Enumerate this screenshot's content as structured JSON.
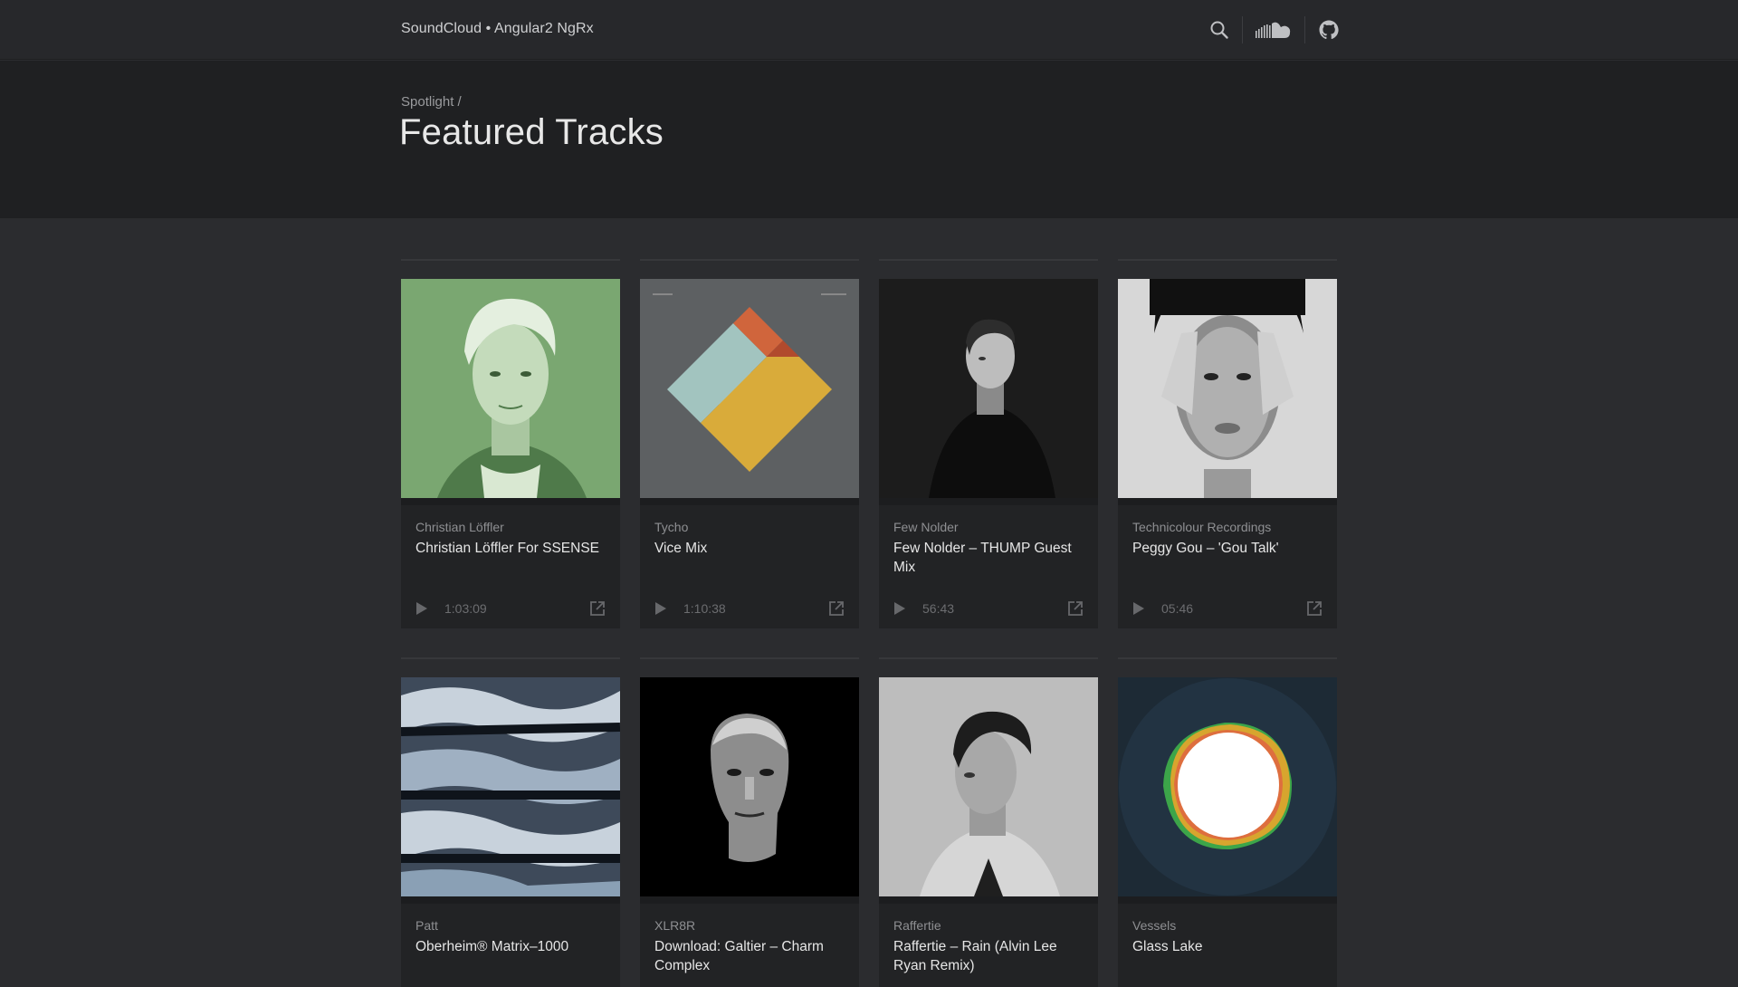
{
  "app": {
    "brand": "SoundCloud • Angular2 NgRx"
  },
  "header": {
    "breadcrumb": "Spotlight /",
    "title": "Featured Tracks"
  },
  "icons": {
    "search": "search-icon",
    "soundcloud": "soundcloud-icon",
    "github": "github-icon",
    "play": "play-icon",
    "external": "external-link-icon"
  },
  "tracks": [
    {
      "artist": "Christian Löffler",
      "title": "Christian Löffler For SSENSE",
      "duration": "1:03:09"
    },
    {
      "artist": "Tycho",
      "title": "Vice Mix",
      "duration": "1:10:38"
    },
    {
      "artist": "Few Nolder",
      "title": "Few Nolder – THUMP Guest Mix",
      "duration": "56:43"
    },
    {
      "artist": "Technicolour Recordings",
      "title": "Peggy Gou – 'Gou Talk'",
      "duration": "05:46"
    },
    {
      "artist": "Patt",
      "title": "Oberheim® Matrix–1000",
      "duration": ""
    },
    {
      "artist": "XLR8R",
      "title": "Download: Galtier – Charm Complex",
      "duration": ""
    },
    {
      "artist": "Raffertie",
      "title": "Raffertie – Rain (Alvin Lee Ryan Remix)",
      "duration": ""
    },
    {
      "artist": "Vessels",
      "title": "Glass Lake",
      "duration": ""
    }
  ],
  "colors": {
    "background": "#2b2c2f",
    "topbar": "#27282b",
    "header": "#1f2022",
    "card": "#222325"
  }
}
